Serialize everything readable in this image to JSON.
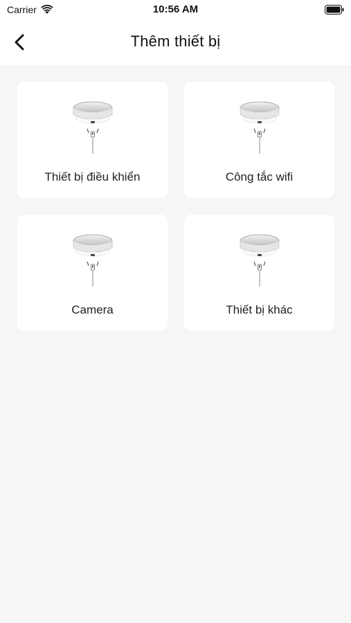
{
  "status_bar": {
    "carrier": "Carrier",
    "time": "10:56 AM"
  },
  "header": {
    "title": "Thêm thiết bị",
    "back_icon": "chevron-left-icon"
  },
  "device_types": [
    {
      "label": "Thiết bị điều khiển",
      "icon": "hub-device-icon"
    },
    {
      "label": "Công tắc wifi",
      "icon": "hub-device-icon"
    },
    {
      "label": "Camera",
      "icon": "hub-device-icon"
    },
    {
      "label": "Thiết bị khác",
      "icon": "hub-device-icon"
    }
  ],
  "colors": {
    "background": "#f6f6f6",
    "card": "#ffffff",
    "text": "#1a1a1a"
  }
}
